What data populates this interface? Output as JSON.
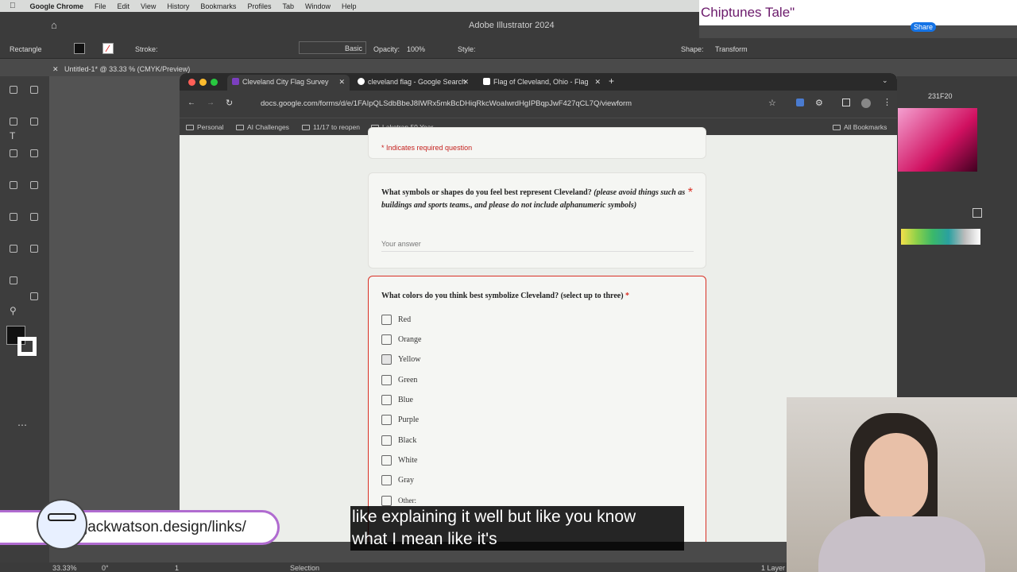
{
  "mac_menu": {
    "app": "Google Chrome",
    "items": [
      "File",
      "Edit",
      "View",
      "History",
      "Bookmarks",
      "Profiles",
      "Tab",
      "Window",
      "Help"
    ]
  },
  "overlay_title": "Chiptunes Tale\"",
  "illustrator": {
    "title": "Adobe Illustrator 2024",
    "tool": "Rectangle",
    "stroke_label": "Stroke:",
    "brush": "Basic",
    "opacity_label": "Opacity:",
    "opacity": "100%",
    "style_label": "Style:",
    "shape_label": "Shape:",
    "transform": "Transform",
    "doc_tab": "Untitled-1* @ 33.33 % (CMYK/Preview)",
    "hex": "231F20",
    "zoom": "33.33%",
    "angle": "0°",
    "artboard": "1",
    "status_tool": "Selection",
    "layers": "1 Layer",
    "share": "Share"
  },
  "browser": {
    "tabs": [
      {
        "label": "Cleveland City Flag Survey"
      },
      {
        "label": "cleveland flag - Google Search"
      },
      {
        "label": "Flag of Cleveland, Ohio - Flag"
      }
    ],
    "url": "docs.google.com/forms/d/e/1FAIpQLSdbBbeJ8IWRx5mkBcDHiqRkcWoaIwrdHgIPBqpJwF427qCL7Q/viewform",
    "bookmarks": [
      "Personal",
      "AI Challenges",
      "11/17 to reopen",
      "Laketran 50 Year...",
      "All Bookmarks"
    ]
  },
  "form": {
    "required_note": "* Indicates required question",
    "q1": {
      "text": "What symbols or shapes do you feel best represent Cleveland?",
      "hint": "(please avoid things such as buildings and sports teams., and please do not include alphanumeric symbols)",
      "placeholder": "Your answer"
    },
    "q2": {
      "text": "What colors do you think best symbolize Cleveland? (select up to three)",
      "options": [
        "Red",
        "Orange",
        "Yellow",
        "Green",
        "Blue",
        "Purple",
        "Black",
        "White",
        "Gray",
        "Other:"
      ]
    }
  },
  "caption": {
    "line1": "like explaining it well but like you know",
    "line2": "what I mean like it's"
  },
  "link": "jackwatson.design/links/",
  "colors": {
    "required": "#c5221f",
    "accent": "#d93025"
  }
}
